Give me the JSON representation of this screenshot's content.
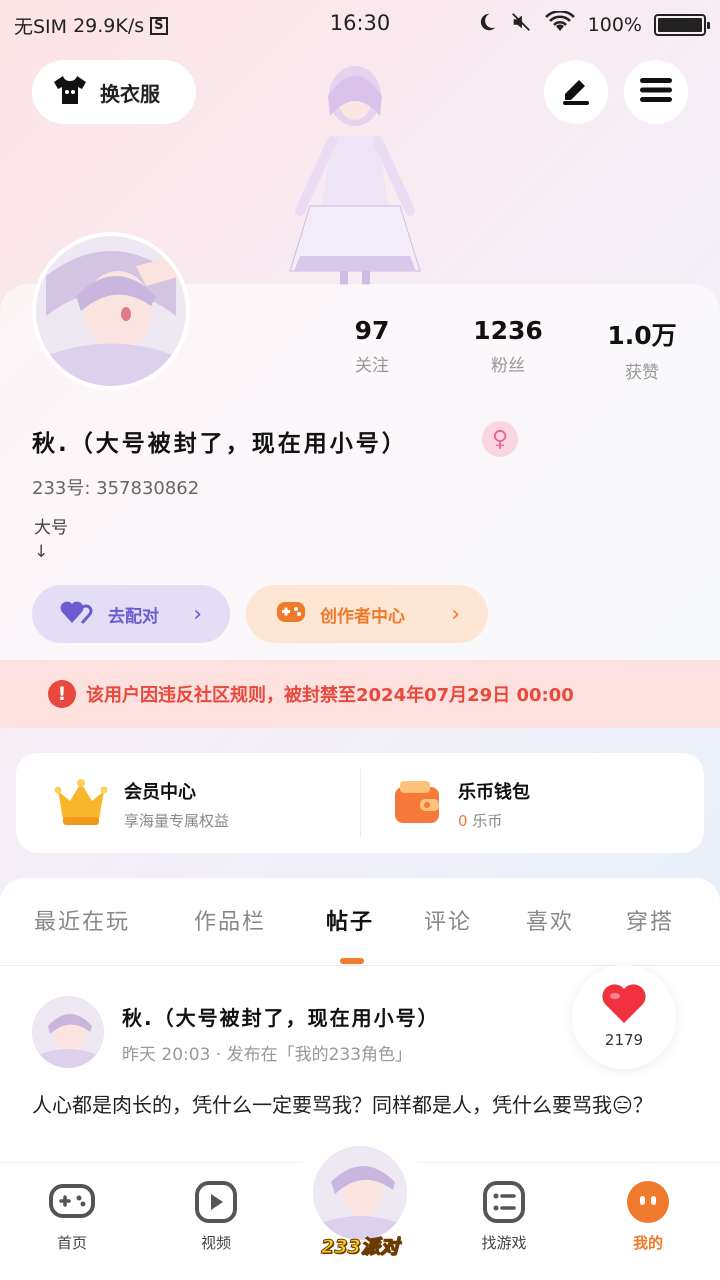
{
  "status_bar": {
    "sim": "无SIM",
    "speed": "29.9K/s",
    "s_icon": "S",
    "time": "16:30",
    "battery": "100%"
  },
  "header": {
    "outfit_label": "换衣服"
  },
  "profile": {
    "stats": [
      {
        "value": "97",
        "label": "关注"
      },
      {
        "value": "1236",
        "label": "粉丝"
      },
      {
        "value": "1.0万",
        "label": "获赞"
      }
    ],
    "name": "秋.（大号被封了，现在用小号）",
    "gender_symbol": "♀",
    "uid": "233号: 357830862",
    "bio_line1": "大号",
    "bio_line2": "↓",
    "match_label": "去配对",
    "creator_label": "创作者中心"
  },
  "ban_notice": "该用户因违反社区规则，被封禁至2024年07月29日 00:00",
  "member": {
    "title": "会员中心",
    "subtitle": "享海量专属权益"
  },
  "wallet": {
    "title": "乐币钱包",
    "amount": "0",
    "unit": "乐币"
  },
  "tabs": [
    "最近在玩",
    "作品栏",
    "帖子",
    "评论",
    "喜欢",
    "穿搭"
  ],
  "active_tab": "帖子",
  "post": {
    "author": "秋.（大号被封了，现在用小号）",
    "meta": "昨天 20:03 · 发布在「我的233角色」",
    "text": "人心都是肉长的，凭什么一定要骂我？同样都是人，凭什么要骂我😑？",
    "likes": "2179"
  },
  "bottom_nav": [
    {
      "label": "首页",
      "icon": "gamepad-icon"
    },
    {
      "label": "视频",
      "icon": "play-icon"
    },
    {
      "label": "233派对",
      "icon": "avatar"
    },
    {
      "label": "找游戏",
      "icon": "list-icon"
    },
    {
      "label": "我的",
      "icon": "face-icon"
    }
  ],
  "colors": {
    "accent": "#f07a2b",
    "ban_red": "#e8493c",
    "purple": "#6d5bd0"
  }
}
